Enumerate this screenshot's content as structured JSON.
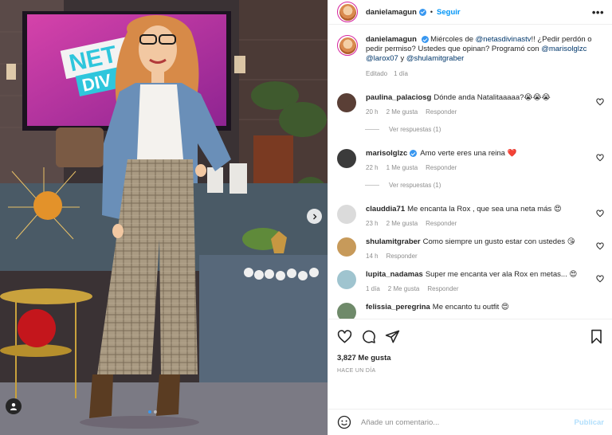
{
  "post": {
    "author": "danielamagun",
    "follow_label": "Seguir",
    "separator": "•",
    "caption": {
      "author": "danielamagun",
      "parts": [
        "Miércoles de ",
        "@netasdivinastv",
        "!! ¿Pedir perdón o pedir permiso? Ustedes que opinan? Programó con ",
        "@marisolglzc",
        " ",
        "@larox07",
        " y ",
        "@shulamitgraber"
      ],
      "edited": "Editado",
      "time": "1 día"
    },
    "comments": [
      {
        "user": "paulina_palaciosg",
        "verified": false,
        "text": "Dónde anda Natalitaaaaa?😭😭😭",
        "time": "20 h",
        "likes": "2 Me gusta",
        "reply": "Responder",
        "replies": "Ver respuestas (1)"
      },
      {
        "user": "marisolglzc",
        "verified": true,
        "text": "Amo verte eres una reina ❤️",
        "time": "22 h",
        "likes": "1 Me gusta",
        "reply": "Responder",
        "replies": "Ver respuestas (1)"
      },
      {
        "user": "clauddia71",
        "verified": false,
        "text": "Me encanta la Rox , que sea una neta más 😍",
        "time": "23 h",
        "likes": "2 Me gusta",
        "reply": "Responder",
        "replies": ""
      },
      {
        "user": "shulamitgraber",
        "verified": false,
        "text": "Como siempre un gusto estar con ustedes 😘",
        "time": "14 h",
        "likes": "",
        "reply": "Responder",
        "replies": ""
      },
      {
        "user": "lupita_nadamas",
        "verified": false,
        "text": "Super me encanta ver ala Rox en metas... 😍",
        "time": "1 día",
        "likes": "2 Me gusta",
        "reply": "Responder",
        "replies": ""
      },
      {
        "user": "felissia_peregrina",
        "verified": false,
        "text": "Me encanto tu outfit 😍",
        "time": "",
        "likes": "",
        "reply": "",
        "replies": ""
      }
    ],
    "likes_count": "3,827",
    "likes_label": "Me gusta",
    "ago": "HACE UN DÍA",
    "comment_placeholder": "Añade un comentario...",
    "publish_label": "Publicar",
    "tv_logo": [
      "NET",
      "DIV"
    ]
  },
  "colors": {
    "accent": "#0095f6",
    "verified": "#3897f0",
    "muted": "#8e8e8e",
    "text": "#262626"
  },
  "carousel": {
    "total": 2,
    "active_index": 0
  }
}
